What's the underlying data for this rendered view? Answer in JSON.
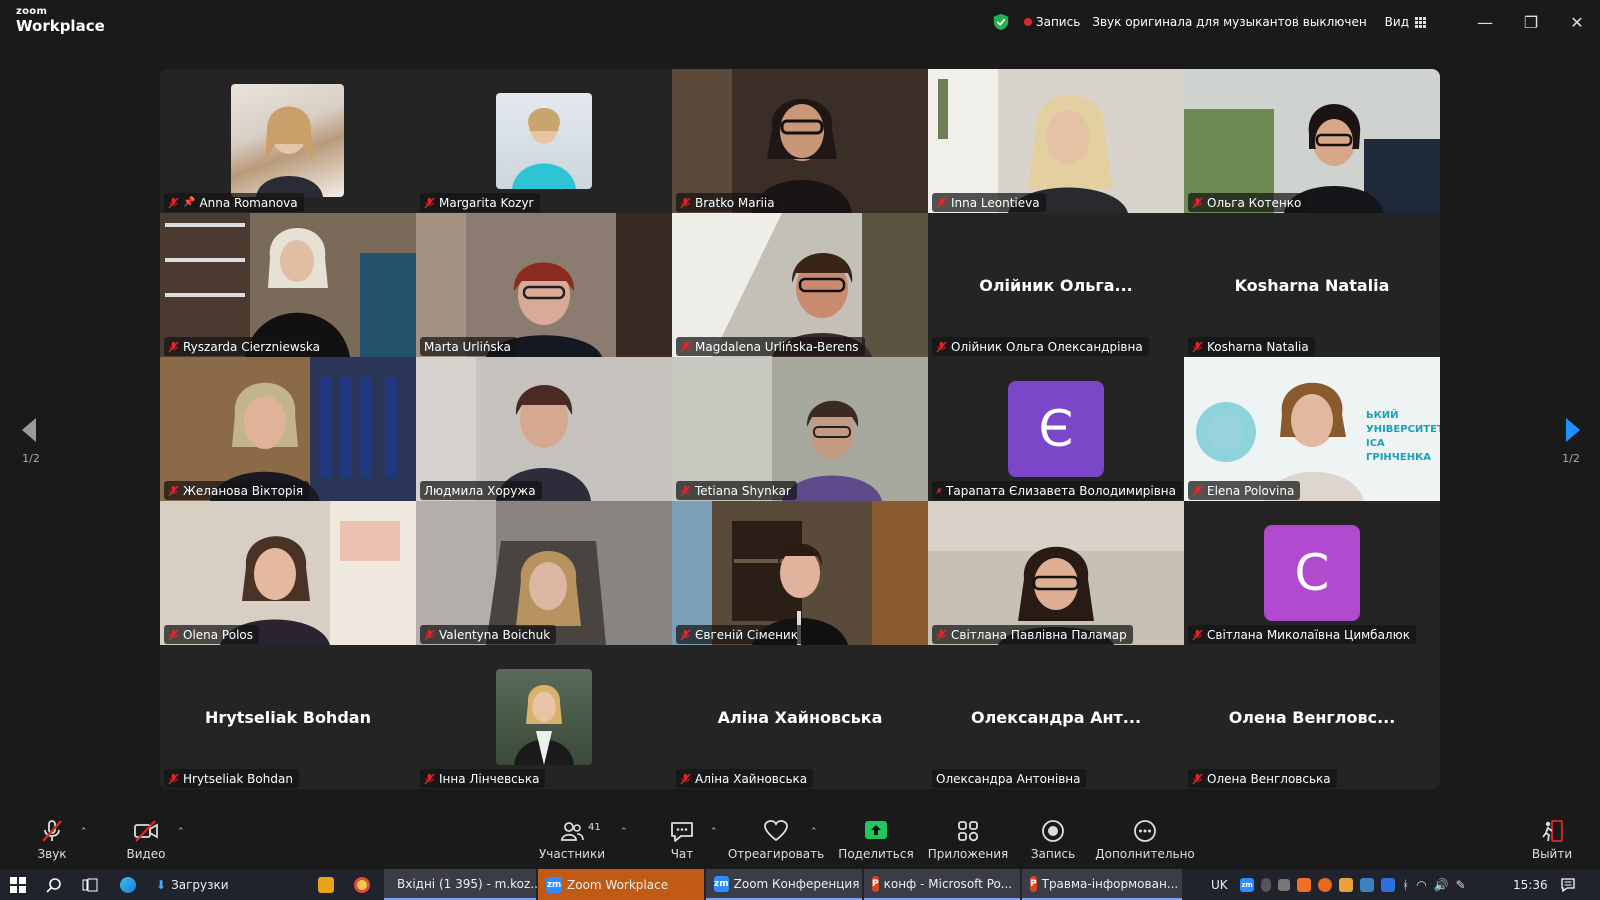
{
  "app": {
    "brand_line1": "zoom",
    "brand_line2": "Workplace"
  },
  "titlebar": {
    "recording_label": "Запись",
    "audio_note": "Звук оригинала для музыкантов выключен",
    "view_label": "Вид",
    "minimize_icon": "minimize-icon",
    "restore_icon": "restore-icon",
    "close_icon": "close-icon"
  },
  "gallery": {
    "page_left": "1/2",
    "page_right": "1/2",
    "tiles": [
      {
        "name": "Anna Romanova",
        "kind": "photo",
        "muted": true,
        "pinned": true
      },
      {
        "name": "Margarita Kozyr",
        "kind": "photo",
        "muted": true
      },
      {
        "name": "Bratko Mariia",
        "kind": "video",
        "muted": true
      },
      {
        "name": "Inna Leontieva",
        "kind": "video",
        "muted": true
      },
      {
        "name": "Ольга Котенко",
        "kind": "video",
        "muted": true
      },
      {
        "name": "Ryszarda Cierzniewska",
        "kind": "video",
        "muted": true
      },
      {
        "name": "Marta Urlińska",
        "kind": "video",
        "muted": false
      },
      {
        "name": "Magdalena Urlińska-Berens",
        "kind": "video",
        "muted": true
      },
      {
        "name": "Олійник Ольга Олександрівна",
        "kind": "name",
        "display": "Олійник  Ольга...",
        "muted": true
      },
      {
        "name": "Kosharna Natalia",
        "kind": "name",
        "display": "Kosharna Natalia",
        "muted": true
      },
      {
        "name": "Желанова Вікторія",
        "kind": "video",
        "muted": true
      },
      {
        "name": "Людмила Хоружа",
        "kind": "video",
        "muted": false,
        "active": true
      },
      {
        "name": "Tetiana Shynkar",
        "kind": "video",
        "muted": true
      },
      {
        "name": "Тарапата Єлизавета Володимирівна",
        "kind": "letter",
        "letter": "Є",
        "muted": true
      },
      {
        "name": "Elena Polovina",
        "kind": "video",
        "muted": true
      },
      {
        "name": "Olena Polos",
        "kind": "video",
        "muted": true
      },
      {
        "name": "Valentyna Boichuk",
        "kind": "video",
        "muted": true
      },
      {
        "name": "Євгеній Сіменик",
        "kind": "video",
        "muted": true
      },
      {
        "name": "Світлана Павлівна Паламар",
        "kind": "video",
        "muted": true
      },
      {
        "name": "Світлана Миколаївна Цимбалюк",
        "kind": "letter",
        "letter": "С",
        "muted": true
      },
      {
        "name": "Hrytseliak Bohdan",
        "kind": "name",
        "display": "Hrytseliak Bohdan",
        "muted": true
      },
      {
        "name": "Інна Лінчевська",
        "kind": "photo",
        "muted": true
      },
      {
        "name": "Аліна Хайновська",
        "kind": "name",
        "display": "Аліна Хайновська",
        "muted": true
      },
      {
        "name": "Олександра Антонівна",
        "kind": "name",
        "display": "Олександра  Ант...",
        "muted": false
      },
      {
        "name": "Олена Венгловська",
        "kind": "name",
        "display": "Олена  Венгловс...",
        "muted": true
      }
    ],
    "banner_lines": [
      "ЬКИЙ",
      "УНІВЕРСИТЕТ",
      "ІСА ГРІНЧЕНКА"
    ]
  },
  "toolbar": {
    "audio_label": "Звук",
    "video_label": "Видео",
    "participants_label": "Участники",
    "participants_count": "41",
    "chat_label": "Чат",
    "react_label": "Отреагировать",
    "share_label": "Поделиться",
    "apps_label": "Приложения",
    "record_label": "Запись",
    "more_label": "Дополнительно",
    "leave_label": "Выйти"
  },
  "taskbar": {
    "downloads": "Загрузки",
    "chrome_tab": "Вхідні (1 395) - m.koz...",
    "zoom_workplace": "Zoom Workplace",
    "zoom_conf": "Zoom Конференция",
    "ppt1": "конф - Microsoft Po...",
    "ppt2": "Травма-інформован...",
    "lang": "UK",
    "time": "15:36"
  },
  "colors": {
    "accent_green": "#2ecc71",
    "share_green": "#22c55e",
    "avatar_purple_1": "#7b46c8",
    "avatar_purple_2": "#b04bd0",
    "mute_red": "#e02828",
    "nav_blue": "#1e90ff"
  }
}
